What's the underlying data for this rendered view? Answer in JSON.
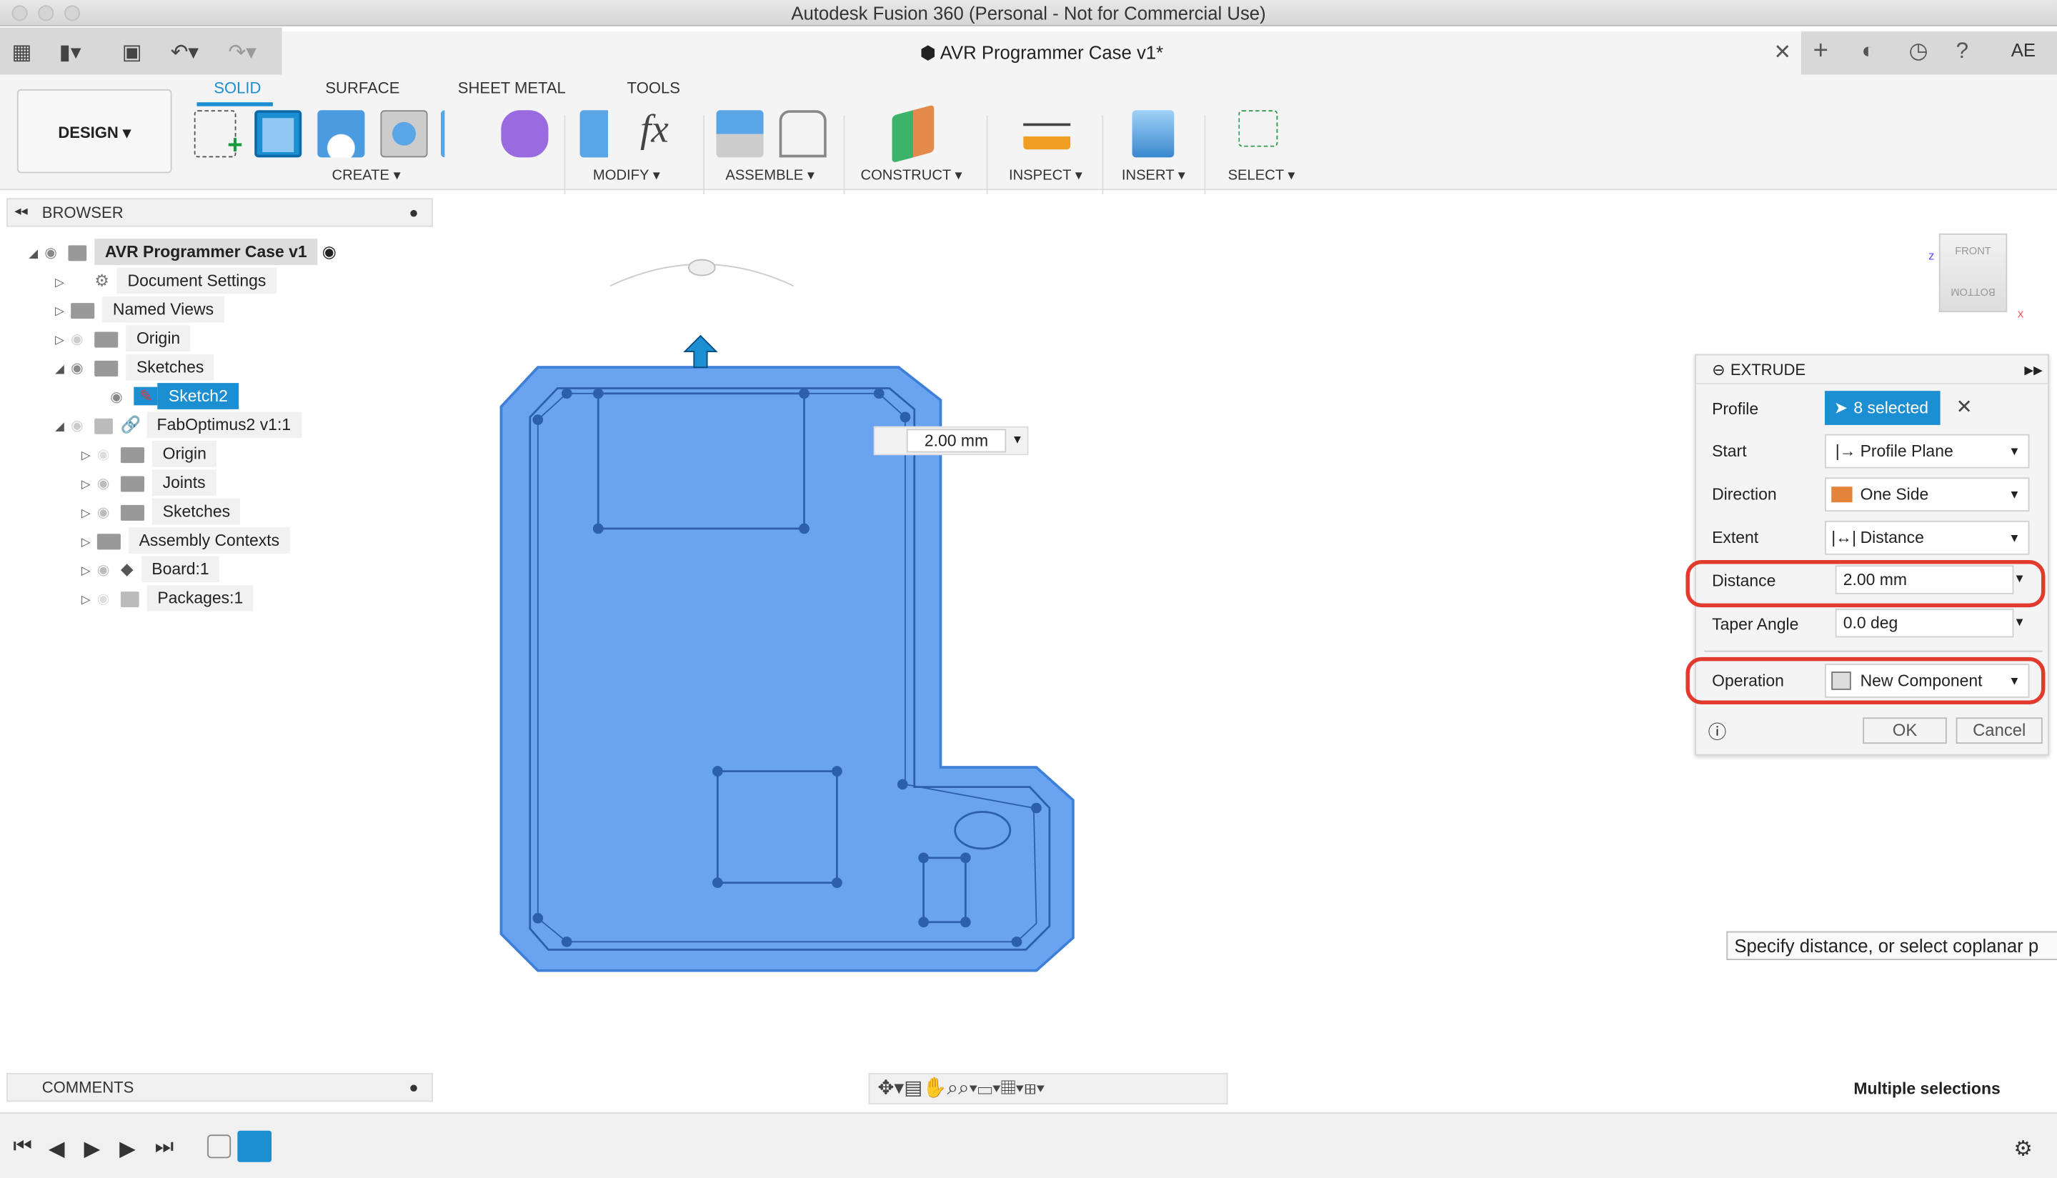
{
  "window": {
    "title": "Autodesk Fusion 360 (Personal - Not for Commercial Use)",
    "document_tab": "AVR Programmer Case v1*"
  },
  "ribbon": {
    "workspace": "DESIGN ▾",
    "tabs": [
      "SOLID",
      "SURFACE",
      "SHEET METAL",
      "TOOLS"
    ],
    "active_tab": "SOLID",
    "groups": [
      "CREATE ▾",
      "MODIFY ▾",
      "ASSEMBLE ▾",
      "CONSTRUCT ▾",
      "INSPECT ▾",
      "INSERT ▾",
      "SELECT ▾"
    ]
  },
  "user_initials": "AE",
  "browser": {
    "title": "BROWSER",
    "items": [
      {
        "label": "AVR Programmer Case v1",
        "level": 0,
        "expanded": true,
        "root": true
      },
      {
        "label": "Document Settings",
        "level": 1,
        "icon": "gear-icon"
      },
      {
        "label": "Named Views",
        "level": 1,
        "icon": "folder-icon"
      },
      {
        "label": "Origin",
        "level": 1,
        "icon": "folder-icon"
      },
      {
        "label": "Sketches",
        "level": 1,
        "icon": "folder-icon",
        "expanded": true
      },
      {
        "label": "Sketch2",
        "level": 2,
        "icon": "sketch-icon",
        "selected": true
      },
      {
        "label": "FabOptimus2 v1:1",
        "level": 1,
        "icon": "link-icon",
        "expanded": true
      },
      {
        "label": "Origin",
        "level": 2,
        "icon": "folder-icon"
      },
      {
        "label": "Joints",
        "level": 2,
        "icon": "folder-icon"
      },
      {
        "label": "Sketches",
        "level": 2,
        "icon": "folder-icon"
      },
      {
        "label": "Assembly Contexts",
        "level": 2,
        "icon": "folder-icon"
      },
      {
        "label": "Board:1",
        "level": 2,
        "icon": "body-icon"
      },
      {
        "label": "Packages:1",
        "level": 2,
        "icon": "component-icon"
      }
    ]
  },
  "viewport": {
    "distance_input": "2.00 mm",
    "viewcube": {
      "front": "FRONT",
      "bottom": "BOTTOM"
    },
    "tooltip": "Specify distance, or select coplanar p",
    "status": "Multiple selections"
  },
  "extrude": {
    "title": "EXTRUDE",
    "profile_label": "Profile",
    "profile_value": "8 selected",
    "start_label": "Start",
    "start_value": "Profile Plane",
    "direction_label": "Direction",
    "direction_value": "One Side",
    "extent_label": "Extent",
    "extent_value": "Distance",
    "distance_label": "Distance",
    "distance_value": "2.00 mm",
    "taper_label": "Taper Angle",
    "taper_value": "0.0 deg",
    "operation_label": "Operation",
    "operation_value": "New Component",
    "ok": "OK",
    "cancel": "Cancel",
    "highlight_color": "#e23b2e"
  },
  "comments": {
    "title": "COMMENTS"
  },
  "colors": {
    "accent": "#1b8fd1",
    "body": "#6aa3f0"
  }
}
